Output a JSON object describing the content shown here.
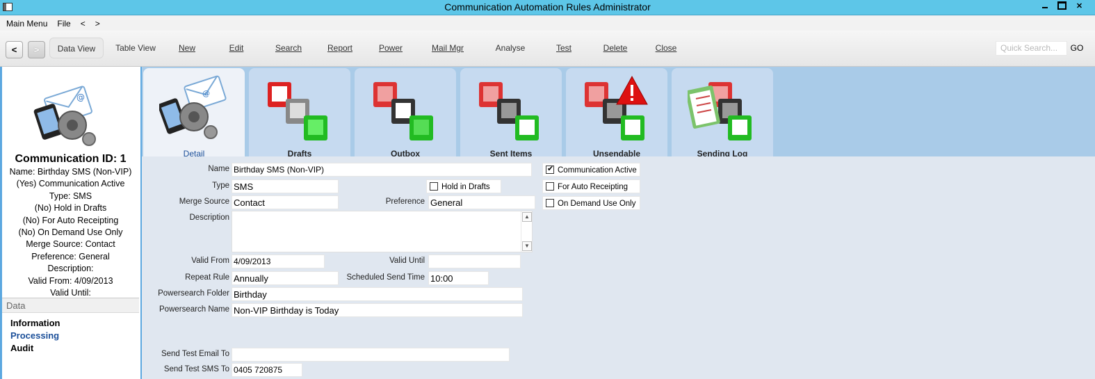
{
  "window": {
    "title": "Communication Automation Rules Administrator"
  },
  "menubar": {
    "items": [
      "Main Menu",
      "File",
      "<",
      ">"
    ]
  },
  "toolbar": {
    "back": "<",
    "forward": ">",
    "items": [
      "Data View",
      "Table View",
      "New",
      "Edit",
      "Search",
      "Report",
      "Power",
      "Mail Mgr",
      "Analyse",
      "Test",
      "Delete",
      "Close"
    ],
    "quick_search_placeholder": "Quick Search...",
    "go_label": "GO"
  },
  "sidebar": {
    "title": "Communication ID: 1",
    "lines": [
      "Name: Birthday SMS (Non-VIP)",
      "(Yes) Communication Active",
      "Type: SMS",
      "(No) Hold in Drafts",
      "(No) For Auto Receipting",
      "(No) On Demand Use Only",
      "Merge Source: Contact",
      "Preference: General",
      "Description:",
      "Valid From: 4/09/2013",
      "Valid Until:"
    ],
    "section_header": "Data",
    "section_items": [
      "Information",
      "Processing",
      "Audit"
    ],
    "selected_item": "Processing"
  },
  "tabs": [
    "Detail",
    "Drafts",
    "Outbox",
    "Sent Items",
    "Unsendable",
    "Sending Log"
  ],
  "active_tab": "Detail",
  "form": {
    "name_label": "Name",
    "name_value": "Birthday SMS (Non-VIP)",
    "type_label": "Type",
    "type_value": "SMS",
    "hold_label": "Hold in Drafts",
    "merge_label": "Merge Source",
    "merge_value": "Contact",
    "preference_label": "Preference",
    "preference_value": "General",
    "description_label": "Description",
    "description_value": "",
    "valid_from_label": "Valid From",
    "valid_from_value": "4/09/2013",
    "valid_until_label": "Valid Until",
    "valid_until_value": "",
    "repeat_label": "Repeat Rule",
    "repeat_value": "Annually",
    "send_time_label": "Scheduled Send Time",
    "send_time_value": "10:00",
    "ps_folder_label": "Powersearch Folder",
    "ps_folder_value": "Birthday",
    "ps_name_label": "Powersearch Name",
    "ps_name_value": "Non-VIP Birthday is Today",
    "test_email_label": "Send Test Email To",
    "test_email_value": "",
    "test_sms_label": "Send Test SMS To",
    "test_sms_value": "0405 720875",
    "comm_active_label": "Communication Active",
    "comm_active": true,
    "auto_receipt_label": "For Auto Receipting",
    "auto_receipt": false,
    "on_demand_label": "On Demand Use Only",
    "on_demand": false,
    "hold_in_drafts": false
  },
  "colors": {
    "titlebar": "#5dc6e8",
    "tabstrip": "#a9cbe8",
    "accent": "#1b4f99"
  }
}
